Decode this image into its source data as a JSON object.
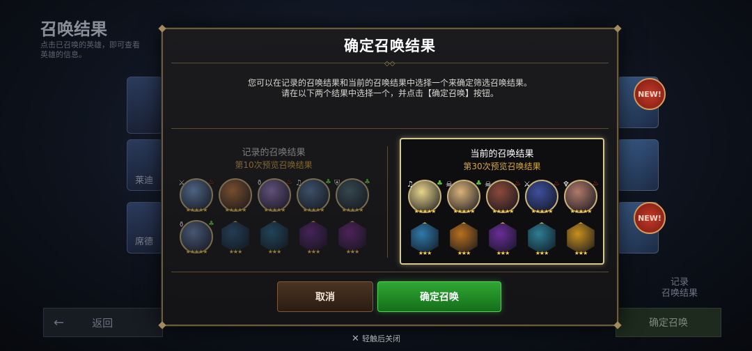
{
  "background": {
    "title": "召唤结果",
    "desc": "点击已召唤的英雄，即可查看英雄的信息。",
    "cards": [
      {
        "label": "莱迪"
      },
      {
        "label": "席德"
      }
    ],
    "new_badge": "NEW!",
    "back_label": "返回",
    "record_label": "记录\n召唤结果",
    "confirm_label": "确定召唤"
  },
  "dialog": {
    "title": "确定召唤结果",
    "message_line1": "您可以在记录的召唤结果和当前的召唤结果中选择一个来确定筛选召唤结果。",
    "message_line2": "请在以下两个结果中选择一个，并点击【确定召唤】按钮。",
    "left_panel": {
      "heading": "记录的召唤结果",
      "subheading": "第10次预览召唤结果",
      "slots": [
        {
          "kind": "hero",
          "color": "#7aa0d8",
          "stars": "★★★★★",
          "element": "sword",
          "attr": "fire"
        },
        {
          "kind": "hero",
          "color": "#c67a42",
          "stars": "★★★★★",
          "element": "",
          "attr": ""
        },
        {
          "kind": "hero",
          "color": "#9b7fc9",
          "stars": "★★★★★",
          "element": "cup",
          "attr": "fire"
        },
        {
          "kind": "hero",
          "color": "#5c7fa8",
          "stars": "★★★★★",
          "element": "music",
          "attr": "earth"
        },
        {
          "kind": "hero",
          "color": "#4d6f7a",
          "stars": "★★★★★",
          "element": "shield",
          "attr": "earth"
        },
        {
          "kind": "hero",
          "color": "#6f8bbd",
          "stars": "★★★★★",
          "element": "cup",
          "attr": "earth"
        },
        {
          "kind": "item",
          "color": "#2f5d86",
          "stars": "★★★",
          "element": "",
          "attr": ""
        },
        {
          "kind": "item",
          "color": "#2a6a8c",
          "stars": "★★★",
          "element": "",
          "attr": ""
        },
        {
          "kind": "item",
          "color": "#6b2f8a",
          "stars": "★★★",
          "element": "",
          "attr": ""
        },
        {
          "kind": "item",
          "color": "#7a2f8e",
          "stars": "★★★",
          "element": "",
          "attr": ""
        }
      ]
    },
    "right_panel": {
      "heading": "当前的召唤结果",
      "subheading": "第30次预览召唤结果",
      "slots": [
        {
          "kind": "hero",
          "color": "#e8d48a",
          "stars": "★★★★★",
          "element": "music",
          "attr": "earth"
        },
        {
          "kind": "hero",
          "color": "#d9b27a",
          "stars": "★★★★★",
          "element": "skull",
          "attr": "earth"
        },
        {
          "kind": "hero",
          "color": "#8b4a3a",
          "stars": "★★★★★",
          "element": "skull",
          "attr": "fire"
        },
        {
          "kind": "hero",
          "color": "#3e4f9a",
          "stars": "★★★★★",
          "element": "sword",
          "attr": "fire"
        },
        {
          "kind": "hero",
          "color": "#b07a6a",
          "stars": "★★★★★",
          "element": "horn",
          "attr": "fire"
        },
        {
          "kind": "item",
          "color": "#2f7aa8",
          "stars": "★★★",
          "element": "",
          "attr": ""
        },
        {
          "kind": "item",
          "color": "#b8701f",
          "stars": "★★★",
          "element": "",
          "attr": ""
        },
        {
          "kind": "item",
          "color": "#6a2e96",
          "stars": "★★★",
          "element": "",
          "attr": ""
        },
        {
          "kind": "item",
          "color": "#2c7e93",
          "stars": "★★★",
          "element": "",
          "attr": ""
        },
        {
          "kind": "item",
          "color": "#c7901e",
          "stars": "★★★",
          "element": "",
          "attr": ""
        }
      ]
    },
    "cancel_label": "取消",
    "confirm_label": "确定召唤"
  },
  "close_hint": "轻触后关闭",
  "colors": {
    "gold_border": "#d8c990",
    "subheading": "#d4a63e",
    "confirm_green": "#2fa733",
    "fire": "#e8462a",
    "earth": "#5fc23a"
  }
}
